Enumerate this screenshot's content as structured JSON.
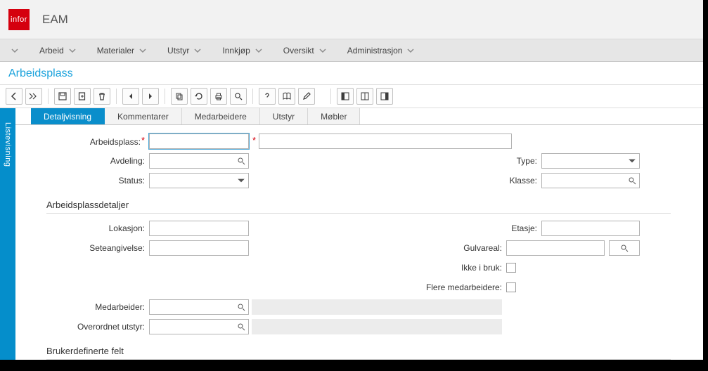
{
  "header": {
    "logo_text": "infor",
    "app_title": "EAM"
  },
  "menubar": {
    "items": [
      "Arbeid",
      "Materialer",
      "Utstyr",
      "Innkjøp",
      "Oversikt",
      "Administrasjon"
    ]
  },
  "page_title": "Arbeidsplass",
  "side_rail": "Listevisning",
  "tabs": [
    "Detaljvisning",
    "Kommentarer",
    "Medarbeidere",
    "Utstyr",
    "Møbler"
  ],
  "form": {
    "labels": {
      "arbeidsplass": "Arbeidsplass:",
      "avdeling": "Avdeling:",
      "status": "Status:",
      "type": "Type:",
      "klasse": "Klasse:",
      "lokasjon": "Lokasjon:",
      "seteangivelse": "Seteangivelse:",
      "etasje": "Etasje:",
      "gulvareal": "Gulvareal:",
      "ikke_i_bruk": "Ikke i bruk:",
      "flere_medarbeidere": "Flere medarbeidere:",
      "medarbeider": "Medarbeider:",
      "overordnet_utstyr": "Overordnet utstyr:"
    },
    "values": {
      "arbeidsplass": "",
      "arbeidsplass_desc": "",
      "avdeling": "",
      "status": "",
      "type": "",
      "klasse": "",
      "lokasjon": "",
      "seteangivelse": "",
      "etasje": "",
      "gulvareal": "",
      "gulvareal_uom": "",
      "medarbeider": "",
      "medarbeider_desc": "",
      "overordnet_utstyr": "",
      "overordnet_utstyr_desc": ""
    }
  },
  "sections": {
    "details": "Arbeidsplassdetaljer",
    "udf": "Brukerdefinerte felt"
  }
}
